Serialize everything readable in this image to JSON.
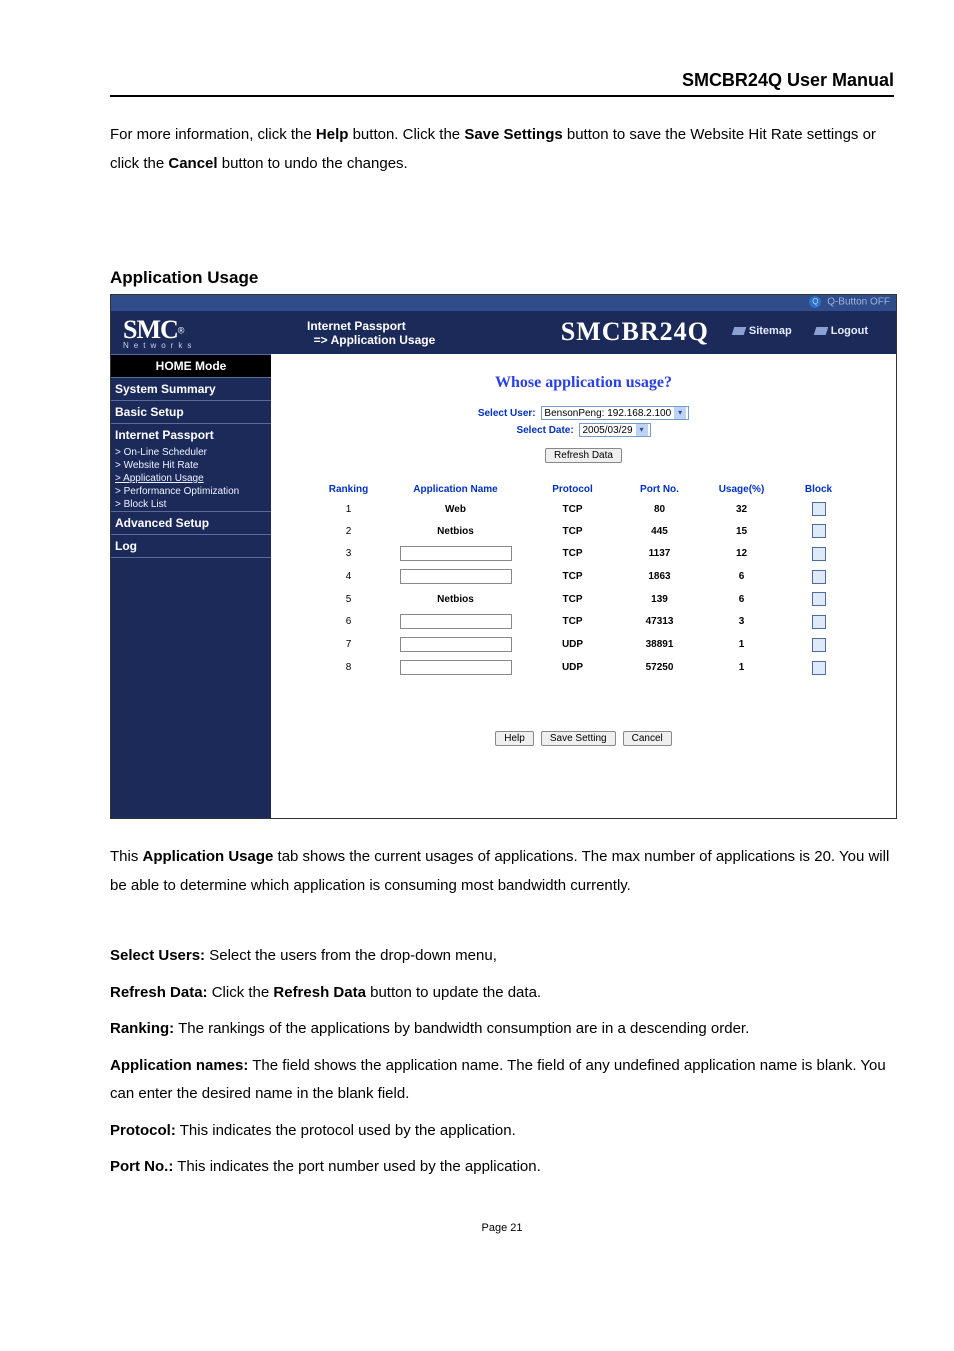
{
  "doc_title": "SMCBR24Q User Manual",
  "intro_html": "For more information, click the <b>Help</b> button. Click the <b>Save Settings</b> button to save the Website Hit Rate settings or click the <b>Cancel</b> button to undo the changes.",
  "section_heading": "Application Usage",
  "ui": {
    "qbutton": "Q-Button OFF",
    "logo_text": "SMC",
    "logo_sub": "Networks",
    "breadcrumb": "Internet Passport\n  => Application Usage",
    "model": "SMCBR24Q",
    "links": {
      "sitemap": "Sitemap",
      "logout": "Logout"
    },
    "sidebar": {
      "mode": "HOME Mode",
      "items": [
        {
          "label": "System Summary",
          "type": "item"
        },
        {
          "label": "Basic Setup",
          "type": "item"
        },
        {
          "label": "Internet Passport",
          "type": "item"
        },
        {
          "label": "> On-Line Scheduler",
          "type": "sub"
        },
        {
          "label": "> Website Hit Rate",
          "type": "sub"
        },
        {
          "label": "> Application Usage",
          "type": "sub",
          "active": true
        },
        {
          "label": "> Performance Optimization",
          "type": "sub"
        },
        {
          "label": "> Block List",
          "type": "sub"
        },
        {
          "label": "Advanced Setup",
          "type": "item"
        },
        {
          "label": "Log",
          "type": "item"
        }
      ]
    },
    "content": {
      "title": "Whose application usage?",
      "select_user_label": "Select User:",
      "select_user_value": "BensonPeng: 192.168.2.100",
      "select_date_label": "Select Date:",
      "select_date_value": "2005/03/29",
      "refresh_btn": "Refresh Data",
      "help_btn": "Help",
      "save_btn": "Save Setting",
      "cancel_btn": "Cancel",
      "headers": {
        "ranking": "Ranking",
        "appname": "Application Name",
        "protocol": "Protocol",
        "port": "Port No.",
        "usage": "Usage(%)",
        "block": "Block"
      },
      "rows": [
        {
          "rank": "1",
          "app": "Web",
          "proto": "TCP",
          "port": "80",
          "usage": "32"
        },
        {
          "rank": "2",
          "app": "Netbios",
          "proto": "TCP",
          "port": "445",
          "usage": "15"
        },
        {
          "rank": "3",
          "app": "",
          "proto": "TCP",
          "port": "1137",
          "usage": "12"
        },
        {
          "rank": "4",
          "app": "",
          "proto": "TCP",
          "port": "1863",
          "usage": "6"
        },
        {
          "rank": "5",
          "app": "Netbios",
          "proto": "TCP",
          "port": "139",
          "usage": "6"
        },
        {
          "rank": "6",
          "app": "",
          "proto": "TCP",
          "port": "47313",
          "usage": "3"
        },
        {
          "rank": "7",
          "app": "",
          "proto": "UDP",
          "port": "38891",
          "usage": "1"
        },
        {
          "rank": "8",
          "app": "",
          "proto": "UDP",
          "port": "57250",
          "usage": "1"
        }
      ]
    }
  },
  "para1_html": "This <b>Application Usage</b> tab shows the current usages of applications. The max number of applications is 20. You will be able to determine which application is consuming most bandwidth currently.",
  "bullets": [
    {
      "html": "<b>Select Users:</b> Select the users from the drop-down menu,"
    },
    {
      "html": "<b>Refresh Data:</b> Click the <b>Refresh Data</b> button to update the data."
    },
    {
      "html": "<b>Ranking:</b> The rankings of the applications by bandwidth consumption are in a descending order."
    },
    {
      "html": "<b>Application names:</b> The field shows the application name. The field of any undefined application name is blank. You can enter the desired name in the blank field."
    },
    {
      "html": "<b>Protocol:</b> This indicates the protocol used by the application."
    },
    {
      "html": "<b>Port No.:</b> This indicates the port number used by the application."
    }
  ],
  "page_number": "Page 21"
}
